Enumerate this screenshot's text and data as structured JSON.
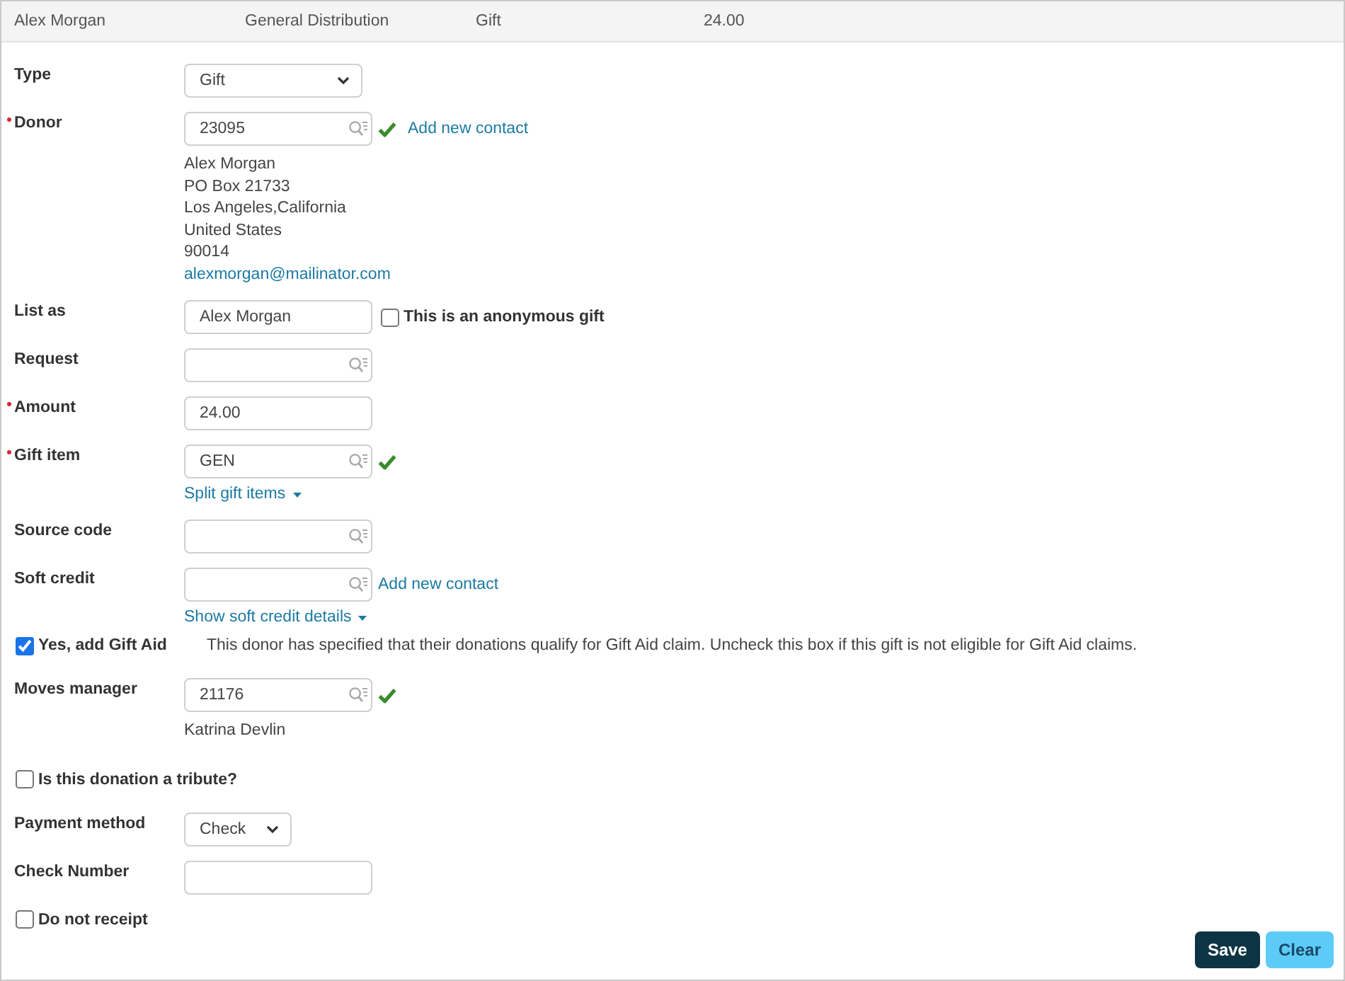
{
  "summary": {
    "cells": [
      "Alex Morgan",
      "General Distribution",
      "Gift",
      "24.00"
    ]
  },
  "form": {
    "rows": [
      {
        "kind": "select",
        "label": "Type",
        "required": false,
        "value": "Gift"
      },
      {
        "kind": "lookup",
        "label": "Donor",
        "required": true,
        "value": "23095",
        "verified": true,
        "link": "Add new contact",
        "details": [
          "Alex Morgan",
          "PO Box 21733",
          "Los Angeles,California",
          "United States",
          "90014"
        ],
        "email": "alexmorgan@mailinator.com"
      },
      {
        "kind": "text",
        "label": "List as",
        "required": false,
        "value": "Alex Morgan",
        "option": {
          "label": "This is an anonymous gift",
          "checked": false
        }
      },
      {
        "kind": "lookup",
        "label": "Request",
        "required": false,
        "verified": false
      },
      {
        "kind": "text",
        "label": "Amount",
        "required": true,
        "value": "24.00"
      },
      {
        "kind": "lookup",
        "label": "Gift item",
        "required": true,
        "value": "GEN",
        "verified": true,
        "toggle": "Split gift items"
      },
      {
        "kind": "lookup",
        "label": "Source code",
        "required": false,
        "verified": false
      },
      {
        "kind": "lookup",
        "label": "Soft credit",
        "required": false,
        "verified": false,
        "link": "Add new contact",
        "toggle": "Show soft credit details"
      },
      {
        "kind": "checkbox",
        "label": "Yes, add Gift Aid",
        "checked": true,
        "note": "This donor has specified that their donations qualify for Gift Aid claim. Uncheck this box if this gift is not eligible for Gift Aid claims."
      },
      {
        "kind": "lookup",
        "label": "Moves manager",
        "required": false,
        "value": "21176",
        "verified": true,
        "details": [
          "Katrina Devlin"
        ]
      },
      {
        "kind": "checkbox",
        "label": "Is this donation a tribute?",
        "checked": false
      },
      {
        "kind": "select",
        "label": "Payment method",
        "required": false,
        "value": "Check"
      },
      {
        "kind": "text",
        "label": "Check Number",
        "required": false
      },
      {
        "kind": "checkbox",
        "label": "Do not receipt",
        "checked": false
      }
    ]
  },
  "buttons": [
    {
      "label": "Save",
      "kind": "primary"
    },
    {
      "label": "Clear",
      "kind": "secondary"
    }
  ]
}
